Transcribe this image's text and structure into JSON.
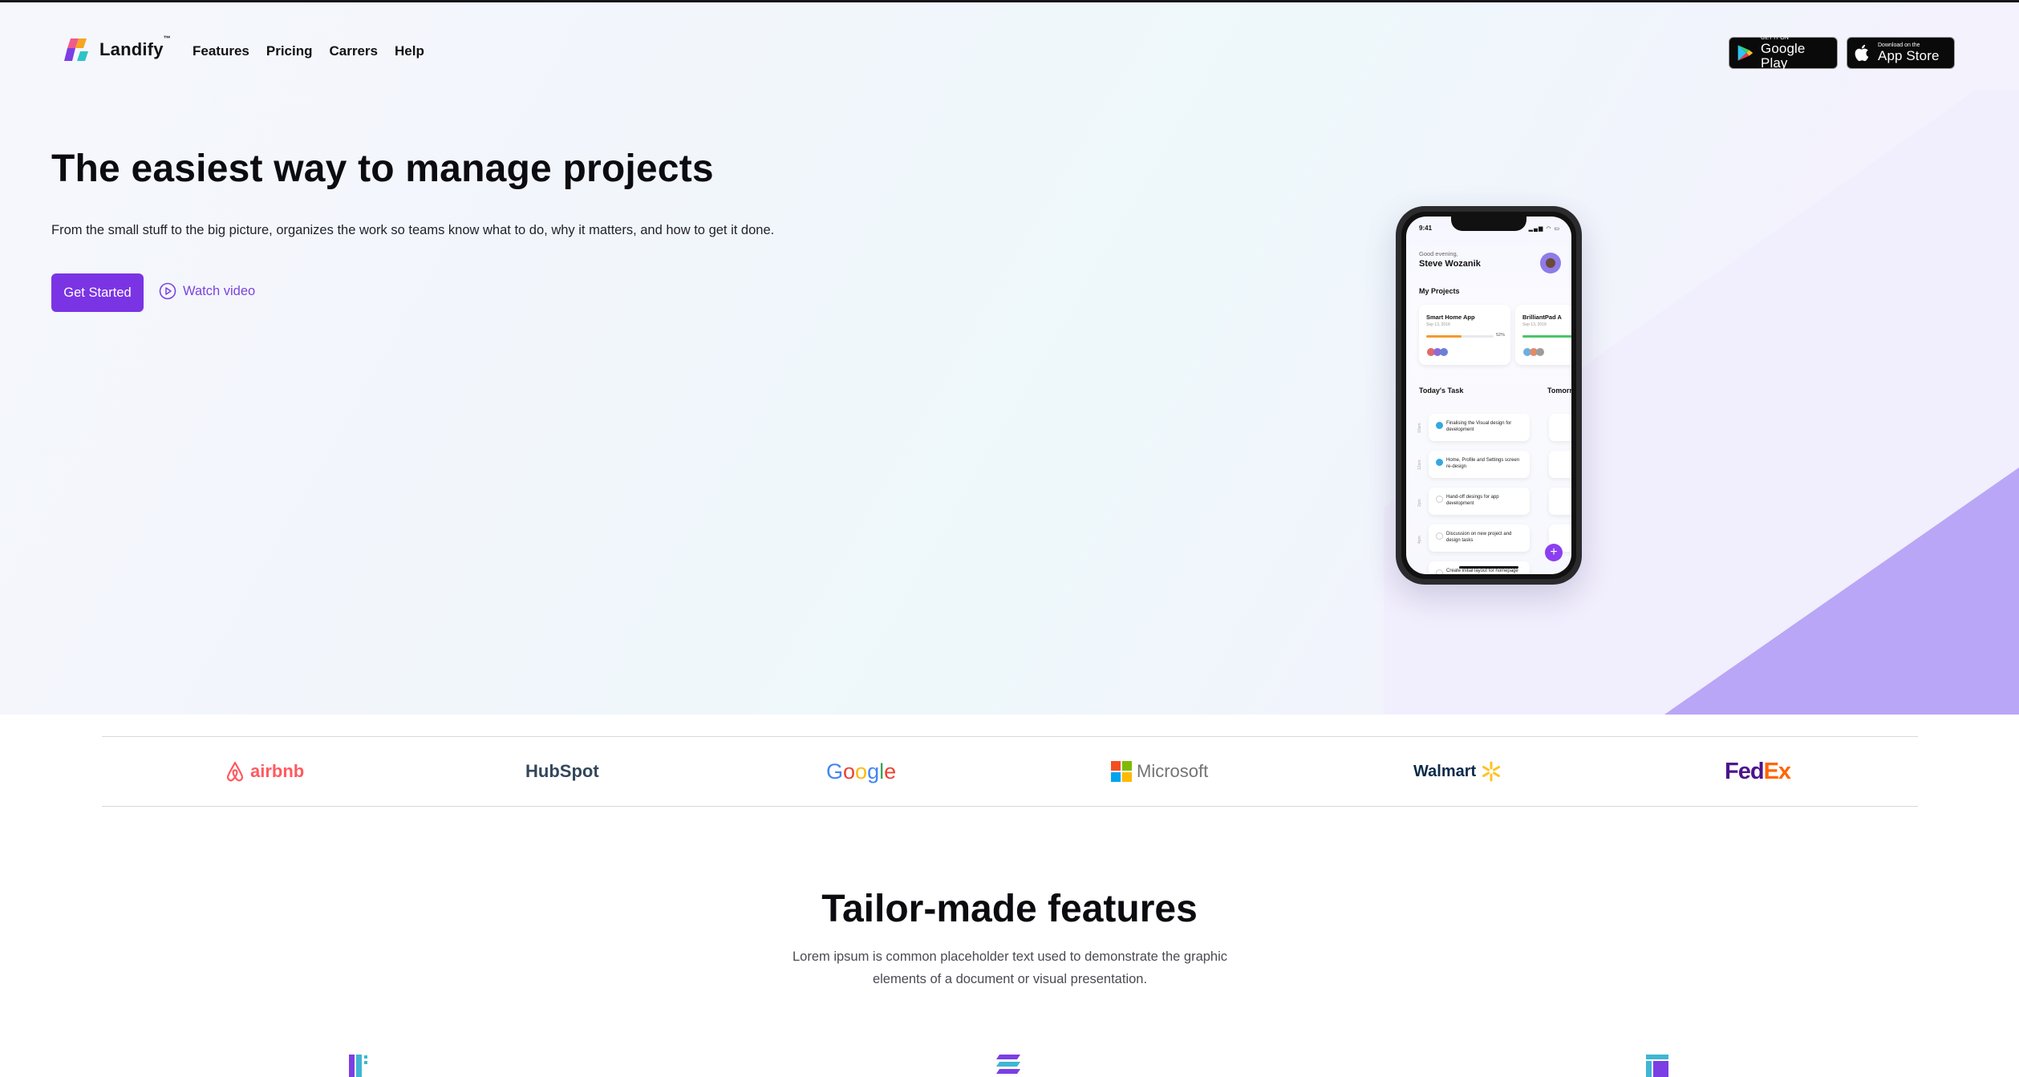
{
  "brand": {
    "name": "Landify",
    "tm": "™"
  },
  "nav": {
    "items": [
      "Features",
      "Pricing",
      "Carrers",
      "Help"
    ]
  },
  "stores": {
    "google": {
      "small": "GET IT ON",
      "big": "Google Play"
    },
    "apple": {
      "small": "Download on the",
      "big": "App Store"
    }
  },
  "hero": {
    "title": "The easiest way to manage projects",
    "subtitle": "From the small stuff to the big picture, organizes the work so teams know what to do, why it matters, and how to get it done.",
    "cta": "Get Started",
    "watch": "Watch video"
  },
  "phone": {
    "time": "9:41",
    "greeting": "Good evening,",
    "user": "Steve Wozanik",
    "my_projects": "My Projects",
    "projects": [
      {
        "name": "Smart Home App",
        "date": "Sep 13, 2018",
        "progress": 0.52,
        "pct": "52%",
        "color": "#f39a2e"
      },
      {
        "name": "BrilliantPad A",
        "date": "Sep 13, 2018",
        "progress": 0.8,
        "pct": "",
        "color": "#4cc36b"
      }
    ],
    "today": "Today's Task",
    "tomorrow": "Tomorr",
    "tasks": [
      {
        "time": "10am",
        "text": "Finalising the Visual design for development",
        "done": true
      },
      {
        "time": "12am",
        "text": "Home, Profile and Settings screen re-design",
        "done": true
      },
      {
        "time": "2pm",
        "text": "Hand-off desings for app development",
        "done": false
      },
      {
        "time": "4pm",
        "text": "Discussion on new project and design tasks",
        "done": false
      },
      {
        "time": "5pm",
        "text": "Create initial layout for homepage design",
        "done": false
      }
    ],
    "fab": "+"
  },
  "partners": [
    "airbnb",
    "HubSpot",
    "Google",
    "Microsoft",
    "Walmart",
    "FedEx"
  ],
  "partner_colors": {
    "airbnb": "#ff5a5f",
    "hubspot": "#33475b",
    "hubspot_o": "#ff7a59",
    "fedex_purple": "#4d148c",
    "fedex_orange": "#ff6600",
    "walmart_blue": "#0a2a4a",
    "walmart_spark": "#ffc220"
  },
  "features": {
    "title": "Tailor-made features",
    "subtitle": "Lorem ipsum is common placeholder text used to demonstrate the graphic elements of a document or visual presentation."
  },
  "colors": {
    "accent": "#7b34e4",
    "hero_shape": "#b7a3f7"
  },
  "icons": [
    "logo-icon",
    "google-play-icon",
    "apple-icon",
    "play-circle-icon",
    "kanban-icon",
    "layers-icon",
    "layout-icon"
  ]
}
